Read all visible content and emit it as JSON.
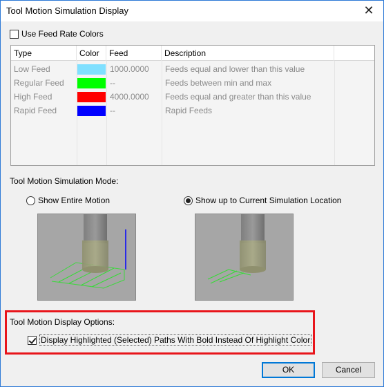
{
  "window": {
    "title": "Tool Motion Simulation Display",
    "close_glyph": "✕"
  },
  "feed_colors": {
    "checkbox_label": "Use Feed Rate Colors",
    "checked": false
  },
  "feed_table": {
    "columns": [
      "Type",
      "Color",
      "Feed",
      "Description"
    ],
    "rows": [
      {
        "type": "Low Feed",
        "color": "#80e0ff",
        "feed": "1000.0000",
        "description": "Feeds equal and lower than this value"
      },
      {
        "type": "Regular Feed",
        "color": "#00ff00",
        "feed": "--",
        "description": "Feeds between min and max"
      },
      {
        "type": "High Feed",
        "color": "#ff0000",
        "feed": "4000.0000",
        "description": "Feeds equal and greater than this value"
      },
      {
        "type": "Rapid Feed",
        "color": "#0000ff",
        "feed": "--",
        "description": "Rapid Feeds"
      }
    ]
  },
  "simulation_mode": {
    "label": "Tool Motion Simulation Mode:",
    "options": [
      {
        "label": "Show Entire Motion",
        "selected": false
      },
      {
        "label": "Show up to Current Simulation Location",
        "selected": true
      }
    ]
  },
  "display_options": {
    "label": "Tool Motion Display Options:",
    "checkbox_label": "Display Highlighted (Selected) Paths With Bold Instead Of Highlight Color",
    "checked": true,
    "highlight_color": "#e8151b"
  },
  "buttons": {
    "ok": "OK",
    "cancel": "Cancel"
  },
  "colors": {
    "accent": "#0078d7",
    "toolpath": "#33dd33",
    "rapid_line": "#0000ff"
  }
}
